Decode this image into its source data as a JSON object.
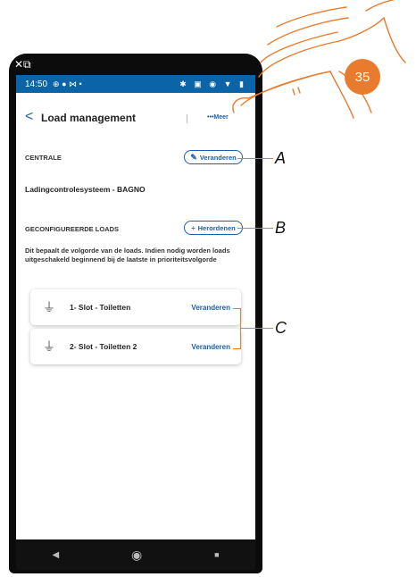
{
  "phone": {
    "status_time": "14:50",
    "status_left_icons": "⊕ ● ⋈ •",
    "status_right_icons": "✱ ▣ ◉ ▼ ▮"
  },
  "header": {
    "back_glyph": "<",
    "title": "Load management",
    "more_dots": "•••",
    "more_label": "Meer"
  },
  "centrale": {
    "heading": "CENTRALE",
    "edit_label": "Veranderen",
    "system_name": "Ladingcontrolesysteem - BAGNO"
  },
  "loads": {
    "heading": "GECONFIGUREERDE LOADS",
    "reorder_label": "Herordenen",
    "description": "Dit bepaalt de volgorde van de loads. Indien nodig worden loads uitgeschakeld beginnend bij de laatste in prioriteitsvolgorde",
    "items": [
      {
        "name": "1- Slot - Toiletten",
        "action": "Veranderen"
      },
      {
        "name": "2- Slot - Toiletten 2",
        "action": "Veranderen"
      }
    ]
  },
  "annotations": {
    "a": "A",
    "b": "B",
    "c": "C",
    "step": "35"
  },
  "nav": {
    "back": "◀",
    "home": "◉",
    "recent": "■"
  },
  "colors": {
    "accent": "#1d5fa8",
    "status_bar": "#0b63a8",
    "annotation": "#e87b2e"
  },
  "icons": [
    "pencil-icon",
    "reorder-icon",
    "plug-icon",
    "chevron-left-icon",
    "hand-pointer"
  ]
}
